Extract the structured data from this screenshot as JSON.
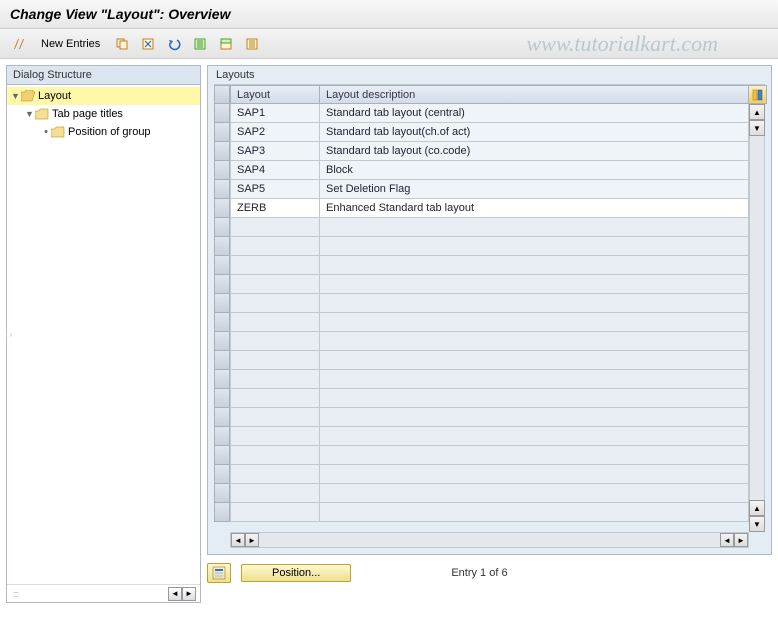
{
  "title": "Change View \"Layout\": Overview",
  "toolbar": {
    "new_entries_label": "New Entries"
  },
  "watermark": "www.tutorialkart.com",
  "tree": {
    "header": "Dialog Structure",
    "root": {
      "label": "Layout"
    },
    "child1": {
      "label": "Tab page titles"
    },
    "child2": {
      "label": "Position of group"
    }
  },
  "grid": {
    "group_label": "Layouts",
    "col_layout": "Layout",
    "col_desc": "Layout description",
    "rows": [
      {
        "layout": "SAP1",
        "desc": "Standard tab layout (central)"
      },
      {
        "layout": "SAP2",
        "desc": "Standard tab layout(ch.of act)"
      },
      {
        "layout": "SAP3",
        "desc": "Standard tab layout (co.code)"
      },
      {
        "layout": "SAP4",
        "desc": "Block"
      },
      {
        "layout": "SAP5",
        "desc": "Set Deletion Flag"
      },
      {
        "layout": "ZERB",
        "desc": "Enhanced Standard tab layout"
      }
    ]
  },
  "footer": {
    "position_label": "Position...",
    "entry_label": "Entry 1 of 6"
  }
}
